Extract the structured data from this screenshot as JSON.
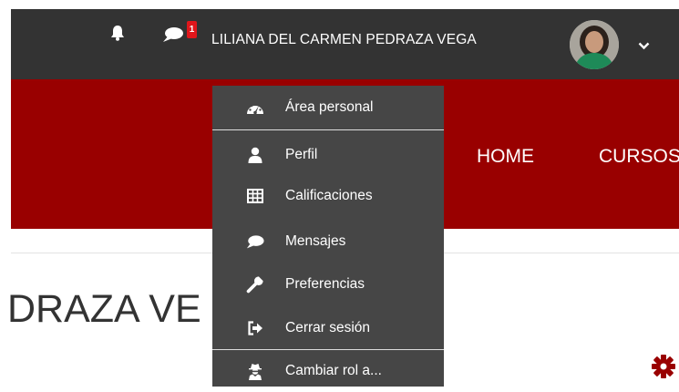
{
  "colors": {
    "topbar": "#333333",
    "brand": "#990000",
    "menu": "#464646",
    "badge": "#e0161b"
  },
  "topbar": {
    "notification_icon": "bell-icon",
    "messages_icon": "chat-bubble-icon",
    "messages_count": "1",
    "user_name": "LILIANA DEL CARMEN PEDRAZA VEGA",
    "user_menu_toggle_icon": "chevron-down-icon"
  },
  "nav": {
    "items": [
      {
        "label": "HOME"
      },
      {
        "label": "CURSOS"
      }
    ]
  },
  "page": {
    "heading": "DRAZA VE",
    "settings_icon": "gear-icon"
  },
  "user_menu": {
    "items": [
      {
        "label": "Área personal",
        "icon": "dashboard-icon"
      },
      {
        "label": "Perfil",
        "icon": "user-icon"
      },
      {
        "label": "Calificaciones",
        "icon": "table-icon"
      },
      {
        "label": "Mensajes",
        "icon": "comment-icon"
      },
      {
        "label": "Preferencias",
        "icon": "wrench-icon"
      },
      {
        "label": "Cerrar sesión",
        "icon": "sign-out-icon"
      },
      {
        "label": "Cambiar rol a...",
        "icon": "user-secret-icon"
      }
    ]
  }
}
